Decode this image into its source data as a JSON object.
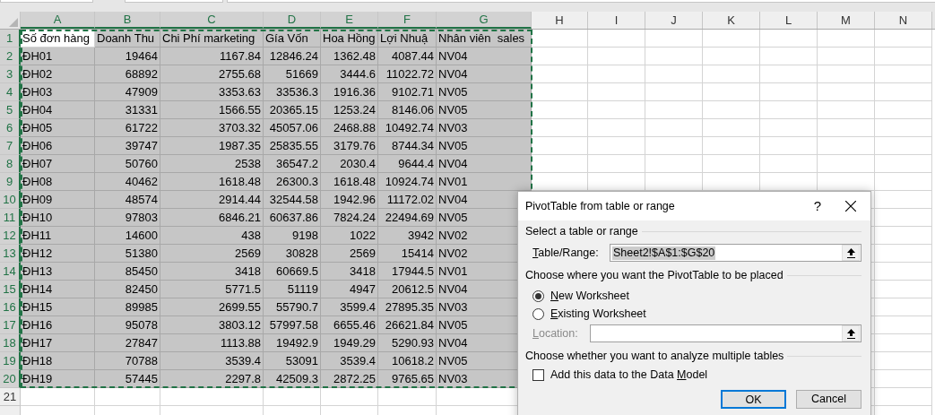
{
  "sheet": {
    "columns": [
      {
        "label": "A",
        "selected": true,
        "kind": "text"
      },
      {
        "label": "B",
        "selected": true,
        "kind": "number"
      },
      {
        "label": "C",
        "selected": true,
        "kind": "number"
      },
      {
        "label": "D",
        "selected": true,
        "kind": "number"
      },
      {
        "label": "E",
        "selected": true,
        "kind": "number"
      },
      {
        "label": "F",
        "selected": true,
        "kind": "number"
      },
      {
        "label": "G",
        "selected": true,
        "kind": "text"
      },
      {
        "label": "H",
        "selected": false,
        "kind": "text"
      },
      {
        "label": "I",
        "selected": false,
        "kind": "text"
      },
      {
        "label": "J",
        "selected": false,
        "kind": "text"
      },
      {
        "label": "K",
        "selected": false,
        "kind": "text"
      },
      {
        "label": "L",
        "selected": false,
        "kind": "text"
      },
      {
        "label": "M",
        "selected": false,
        "kind": "text"
      },
      {
        "label": "N",
        "selected": false,
        "kind": "text"
      }
    ],
    "rows": [
      {
        "label": "1",
        "selected": true,
        "kind": "header",
        "cells": [
          {
            "text": "Số đơn hàng",
            "active": true
          },
          {
            "text": "Doanh Thu",
            "active": false
          },
          {
            "text": "Chi Phí marketing",
            "active": false
          },
          {
            "text": "Gía Vốn",
            "active": false
          },
          {
            "text": "Hoa Hồng",
            "active": false
          },
          {
            "text": "Lợi Nhuậ",
            "active": false
          },
          {
            "text": "Nhân viên  sales",
            "active": false
          }
        ]
      },
      {
        "label": "2",
        "selected": true,
        "kind": "data",
        "cells": [
          "ĐH01",
          "19464",
          "1167.84",
          "12846.24",
          "1362.48",
          "4087.44",
          "NV04"
        ]
      },
      {
        "label": "3",
        "selected": true,
        "kind": "data",
        "cells": [
          "ĐH02",
          "68892",
          "2755.68",
          "51669",
          "3444.6",
          "11022.72",
          "NV04"
        ]
      },
      {
        "label": "4",
        "selected": true,
        "kind": "data",
        "cells": [
          "ĐH03",
          "47909",
          "3353.63",
          "33536.3",
          "1916.36",
          "9102.71",
          "NV05"
        ]
      },
      {
        "label": "5",
        "selected": true,
        "kind": "data",
        "cells": [
          "ĐH04",
          "31331",
          "1566.55",
          "20365.15",
          "1253.24",
          "8146.06",
          "NV05"
        ]
      },
      {
        "label": "6",
        "selected": true,
        "kind": "data",
        "cells": [
          "ĐH05",
          "61722",
          "3703.32",
          "45057.06",
          "2468.88",
          "10492.74",
          "NV03"
        ]
      },
      {
        "label": "7",
        "selected": true,
        "kind": "data",
        "cells": [
          "ĐH06",
          "39747",
          "1987.35",
          "25835.55",
          "3179.76",
          "8744.34",
          "NV05"
        ]
      },
      {
        "label": "8",
        "selected": true,
        "kind": "data",
        "cells": [
          "ĐH07",
          "50760",
          "2538",
          "36547.2",
          "2030.4",
          "9644.4",
          "NV04"
        ]
      },
      {
        "label": "9",
        "selected": true,
        "kind": "data",
        "cells": [
          "ĐH08",
          "40462",
          "1618.48",
          "26300.3",
          "1618.48",
          "10924.74",
          "NV01"
        ]
      },
      {
        "label": "10",
        "selected": true,
        "kind": "data",
        "cells": [
          "ĐH09",
          "48574",
          "2914.44",
          "32544.58",
          "1942.96",
          "11172.02",
          "NV04"
        ]
      },
      {
        "label": "11",
        "selected": true,
        "kind": "data",
        "cells": [
          "ĐH10",
          "97803",
          "6846.21",
          "60637.86",
          "7824.24",
          "22494.69",
          "NV05"
        ]
      },
      {
        "label": "12",
        "selected": true,
        "kind": "data",
        "cells": [
          "ĐH11",
          "14600",
          "438",
          "9198",
          "1022",
          "3942",
          "NV02"
        ]
      },
      {
        "label": "13",
        "selected": true,
        "kind": "data",
        "cells": [
          "ĐH12",
          "51380",
          "2569",
          "30828",
          "2569",
          "15414",
          "NV02"
        ]
      },
      {
        "label": "14",
        "selected": true,
        "kind": "data",
        "cells": [
          "ĐH13",
          "85450",
          "3418",
          "60669.5",
          "3418",
          "17944.5",
          "NV01"
        ]
      },
      {
        "label": "15",
        "selected": true,
        "kind": "data",
        "cells": [
          "ĐH14",
          "82450",
          "5771.5",
          "51119",
          "4947",
          "20612.5",
          "NV04"
        ]
      },
      {
        "label": "16",
        "selected": true,
        "kind": "data",
        "cells": [
          "ĐH15",
          "89985",
          "2699.55",
          "55790.7",
          "3599.4",
          "27895.35",
          "NV03"
        ]
      },
      {
        "label": "17",
        "selected": true,
        "kind": "data",
        "cells": [
          "ĐH16",
          "95078",
          "3803.12",
          "57997.58",
          "6655.46",
          "26621.84",
          "NV05"
        ]
      },
      {
        "label": "18",
        "selected": true,
        "kind": "data",
        "cells": [
          "ĐH17",
          "27847",
          "1113.88",
          "19492.9",
          "1949.29",
          "5290.93",
          "NV04"
        ]
      },
      {
        "label": "19",
        "selected": true,
        "kind": "data",
        "cells": [
          "ĐH18",
          "70788",
          "3539.4",
          "53091",
          "3539.4",
          "10618.2",
          "NV05"
        ]
      },
      {
        "label": "20",
        "selected": true,
        "kind": "data",
        "cells": [
          "ĐH19",
          "57445",
          "2297.8",
          "42509.3",
          "2872.25",
          "9765.65",
          "NV03"
        ]
      },
      {
        "label": "21",
        "selected": false,
        "kind": "empty",
        "cells": []
      }
    ]
  },
  "dialog": {
    "title": "PivotTable from table or range",
    "help": "?",
    "section_1": "Select a table or range",
    "range_field": {
      "label": {
        "key": "T",
        "after": "able/Range:"
      },
      "value": "Sheet2!$A$1:$G$20",
      "disabled": false
    },
    "section_2": "Choose where you want the PivotTable to be placed",
    "placement": [
      {
        "label": {
          "key": "N",
          "after": "ew Worksheet"
        },
        "selected": true
      },
      {
        "label": {
          "key": "E",
          "after": "xisting Worksheet"
        },
        "selected": false
      }
    ],
    "location_field": {
      "label": {
        "key": "L",
        "after": "ocation:"
      },
      "disabled": true
    },
    "section_3": "Choose whether you want to analyze multiple tables",
    "data_model": {
      "label": {
        "before": "Add this data to the Data ",
        "key": "M",
        "after": "odel"
      },
      "checked": false
    },
    "buttons": [
      {
        "label": "OK",
        "default": true
      },
      {
        "label": "Cancel",
        "default": false
      }
    ]
  }
}
